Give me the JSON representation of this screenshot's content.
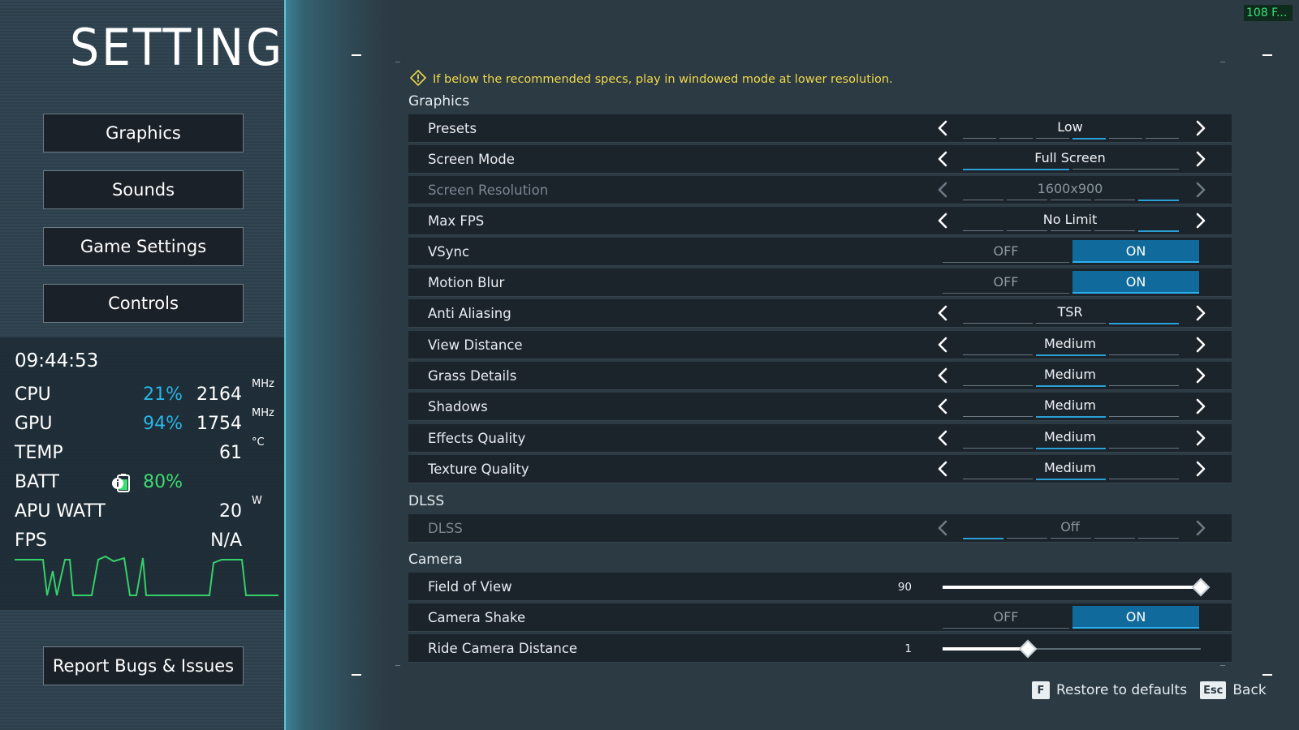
{
  "sidebar": {
    "title": "SETTINGS",
    "nav": [
      {
        "label": "Graphics"
      },
      {
        "label": "Sounds"
      },
      {
        "label": "Game Settings"
      },
      {
        "label": "Controls"
      }
    ],
    "report_label": "Report Bugs & Issues"
  },
  "overlay": {
    "clock": "09:44:53",
    "cpu": {
      "label": "CPU",
      "pct": "21%",
      "val": "2164",
      "unit": "MHz"
    },
    "gpu": {
      "label": "GPU",
      "pct": "94%",
      "val": "1754",
      "unit": "MHz"
    },
    "temp": {
      "label": "TEMP",
      "val": "61",
      "unit": "°C"
    },
    "batt": {
      "label": "BATT",
      "pct": "80%",
      "icon": "battery-icon"
    },
    "apu": {
      "label": "APU WATT",
      "val": "20",
      "unit": "W"
    },
    "fps": {
      "label": "FPS",
      "val": "N/A"
    },
    "colors": {
      "accent": "#29b6e8",
      "batt": "#3ddc72",
      "graph": "#35d06a"
    }
  },
  "fps_badge": "108 F...",
  "warning": {
    "icon": "warning-diamond-icon",
    "text": "If below the recommended specs, play in windowed mode at lower resolution."
  },
  "sections": {
    "graphics": "Graphics",
    "dlss": "DLSS",
    "camera": "Camera"
  },
  "rows": {
    "presets": {
      "label": "Presets",
      "value": "Low"
    },
    "screen_mode": {
      "label": "Screen Mode",
      "value": "Full Screen"
    },
    "screen_resolution": {
      "label": "Screen Resolution",
      "value": "1600x900"
    },
    "max_fps": {
      "label": "Max FPS",
      "value": "No Limit"
    },
    "vsync": {
      "label": "VSync",
      "off": "OFF",
      "on": "ON"
    },
    "motion_blur": {
      "label": "Motion Blur",
      "off": "OFF",
      "on": "ON"
    },
    "anti_aliasing": {
      "label": "Anti Aliasing",
      "value": "TSR"
    },
    "view_distance": {
      "label": "View Distance",
      "value": "Medium"
    },
    "grass_details": {
      "label": "Grass Details",
      "value": "Medium"
    },
    "shadows": {
      "label": "Shadows",
      "value": "Medium"
    },
    "effects_quality": {
      "label": "Effects Quality",
      "value": "Medium"
    },
    "texture_quality": {
      "label": "Texture Quality",
      "value": "Medium"
    },
    "dlss": {
      "label": "DLSS",
      "value": "Off"
    },
    "fov": {
      "label": "Field of View",
      "value": "90",
      "fraction": 1.0
    },
    "camera_shake": {
      "label": "Camera Shake",
      "off": "OFF",
      "on": "ON"
    },
    "ride_camera_distance": {
      "label": "Ride Camera Distance",
      "value": "1",
      "fraction": 0.33
    }
  },
  "footer": {
    "restore_key": "F",
    "restore_label": "Restore to defaults",
    "back_key": "Esc",
    "back_label": "Back"
  }
}
